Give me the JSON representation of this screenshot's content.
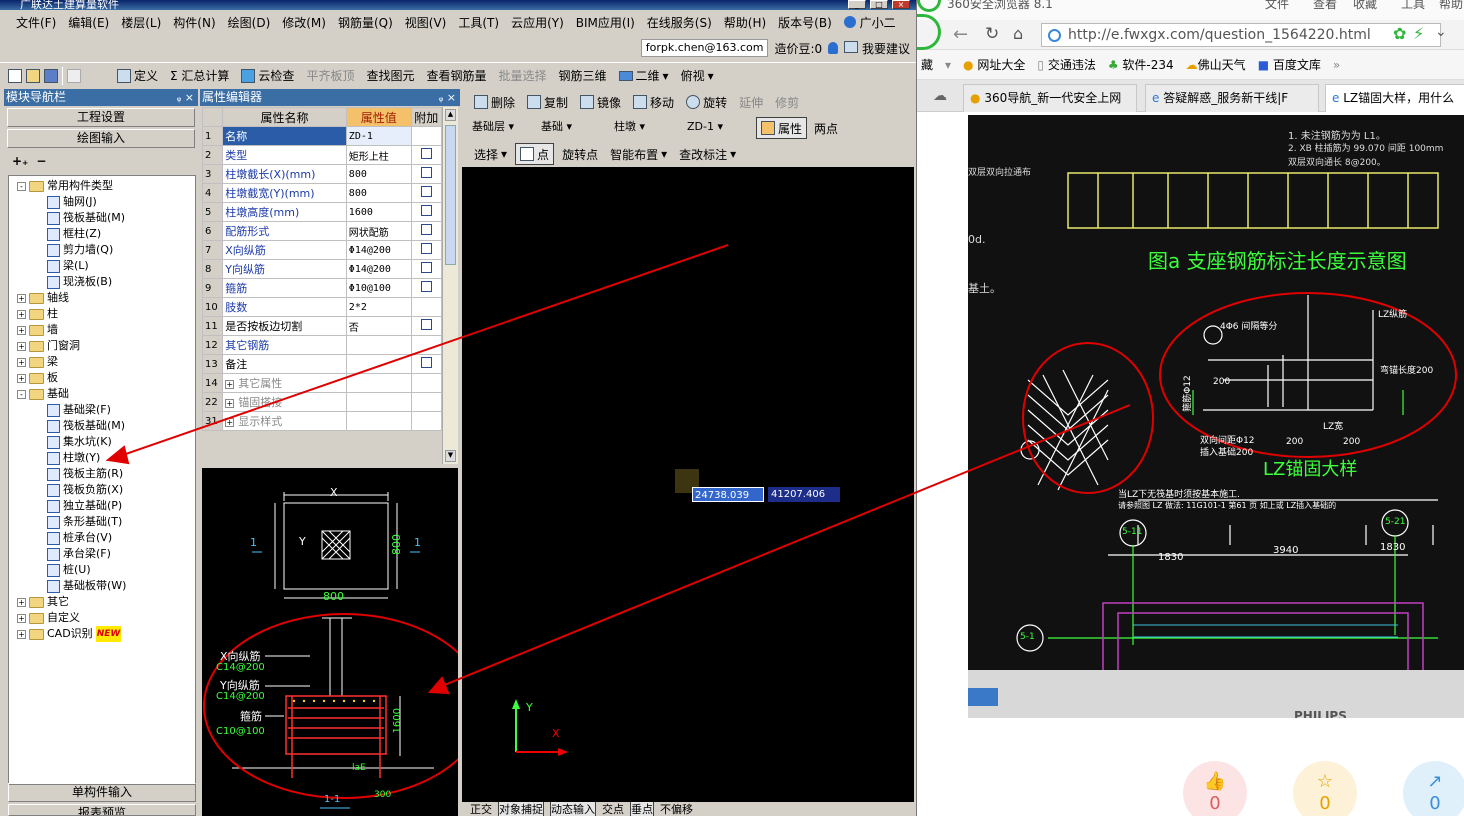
{
  "app": {
    "title": "广联达土建算量软件",
    "menu": [
      "文件(F)",
      "编辑(E)",
      "楼层(L)",
      "构件(N)",
      "绘图(D)",
      "修改(M)",
      "钢筋量(Q)",
      "视图(V)",
      "工具(T)",
      "云应用(Y)",
      "BIM应用(I)",
      "在线服务(S)",
      "帮助(H)",
      "版本号(B)",
      "广小二"
    ],
    "account": "forpk.chen@163.com",
    "price_bean": "造价豆:0",
    "suggest": "我要建议",
    "toolbar": [
      "定义",
      "Σ 汇总计算",
      "云检查",
      "平齐板顶",
      "查找图元",
      "查看钢筋量",
      "批量选择",
      "钢筋三维",
      "二维",
      "俯视"
    ],
    "colors": {
      "title": "#0a246a",
      "accent": "#3a6ea5",
      "cad_bg": "#000000",
      "red": "#e00000"
    }
  },
  "nav": {
    "title": "模块导航栏",
    "btn_project": "工程设置",
    "btn_draw": "绘图输入",
    "tree": [
      {
        "label": "常用构件类型",
        "type": "folder",
        "level": 0,
        "exp": "-"
      },
      {
        "label": "轴网(J)",
        "type": "leaf",
        "level": 1
      },
      {
        "label": "筏板基础(M)",
        "type": "leaf",
        "level": 1
      },
      {
        "label": "框柱(Z)",
        "type": "leaf",
        "level": 1
      },
      {
        "label": "剪力墙(Q)",
        "type": "leaf",
        "level": 1
      },
      {
        "label": "梁(L)",
        "type": "leaf",
        "level": 1
      },
      {
        "label": "现浇板(B)",
        "type": "leaf",
        "level": 1
      },
      {
        "label": "轴线",
        "type": "folder",
        "level": 0,
        "exp": "+"
      },
      {
        "label": "柱",
        "type": "folder",
        "level": 0,
        "exp": "+"
      },
      {
        "label": "墙",
        "type": "folder",
        "level": 0,
        "exp": "+"
      },
      {
        "label": "门窗洞",
        "type": "folder",
        "level": 0,
        "exp": "+"
      },
      {
        "label": "梁",
        "type": "folder",
        "level": 0,
        "exp": "+"
      },
      {
        "label": "板",
        "type": "folder",
        "level": 0,
        "exp": "+"
      },
      {
        "label": "基础",
        "type": "folder",
        "level": 0,
        "exp": "-"
      },
      {
        "label": "基础梁(F)",
        "type": "leaf",
        "level": 1
      },
      {
        "label": "筏板基础(M)",
        "type": "leaf",
        "level": 1
      },
      {
        "label": "集水坑(K)",
        "type": "leaf",
        "level": 1
      },
      {
        "label": "柱墩(Y)",
        "type": "leaf",
        "level": 1
      },
      {
        "label": "筏板主筋(R)",
        "type": "leaf",
        "level": 1
      },
      {
        "label": "筏板负筋(X)",
        "type": "leaf",
        "level": 1
      },
      {
        "label": "独立基础(P)",
        "type": "leaf",
        "level": 1
      },
      {
        "label": "条形基础(T)",
        "type": "leaf",
        "level": 1
      },
      {
        "label": "桩承台(V)",
        "type": "leaf",
        "level": 1
      },
      {
        "label": "承台梁(F)",
        "type": "leaf",
        "level": 1
      },
      {
        "label": "桩(U)",
        "type": "leaf",
        "level": 1
      },
      {
        "label": "基础板带(W)",
        "type": "leaf",
        "level": 1
      },
      {
        "label": "其它",
        "type": "folder",
        "level": 0,
        "exp": "+"
      },
      {
        "label": "自定义",
        "type": "folder",
        "level": 0,
        "exp": "+"
      },
      {
        "label": "CAD识别",
        "type": "folder",
        "level": 0,
        "exp": "+",
        "badge": "NEW"
      }
    ],
    "btn_single": "单构件输入",
    "btn_report": "报表预览"
  },
  "prop": {
    "title": "属性编辑器",
    "col_name": "属性名称",
    "col_value": "属性值",
    "col_extra": "附加",
    "rows": [
      {
        "n": "1",
        "name": "名称",
        "value": "ZD-1",
        "ck": false,
        "style": "sel"
      },
      {
        "n": "2",
        "name": "类型",
        "value": "矩形上柱",
        "ck": true,
        "style": ""
      },
      {
        "n": "3",
        "name": "柱墩截长(X)(mm)",
        "value": "800",
        "ck": true,
        "style": ""
      },
      {
        "n": "4",
        "name": "柱墩截宽(Y)(mm)",
        "value": "800",
        "ck": true,
        "style": ""
      },
      {
        "n": "5",
        "name": "柱墩高度(mm)",
        "value": "1600",
        "ck": true,
        "style": ""
      },
      {
        "n": "6",
        "name": "配筋形式",
        "value": "网状配筋",
        "ck": true,
        "style": ""
      },
      {
        "n": "7",
        "name": "X向纵筋",
        "value": "Φ14@200",
        "ck": true,
        "style": ""
      },
      {
        "n": "8",
        "name": "Y向纵筋",
        "value": "Φ14@200",
        "ck": true,
        "style": ""
      },
      {
        "n": "9",
        "name": "箍筋",
        "value": "Φ10@100",
        "ck": true,
        "style": ""
      },
      {
        "n": "10",
        "name": "肢数",
        "value": "2*2",
        "ck": false,
        "style": ""
      },
      {
        "n": "11",
        "name": "是否按板边切割",
        "value": "否",
        "ck": true,
        "style": "black"
      },
      {
        "n": "12",
        "name": "其它钢筋",
        "value": "",
        "ck": false,
        "style": ""
      },
      {
        "n": "13",
        "name": "备注",
        "value": "",
        "ck": true,
        "style": "black"
      },
      {
        "n": "14",
        "name": "其它属性",
        "value": "",
        "ck": false,
        "style": "gray",
        "expand": "+"
      },
      {
        "n": "22",
        "name": "锚固搭接",
        "value": "",
        "ck": false,
        "style": "gray",
        "expand": "+"
      },
      {
        "n": "31",
        "name": "显示样式",
        "value": "",
        "ck": false,
        "style": "gray",
        "expand": "+"
      }
    ]
  },
  "preview": {
    "x_label": "X",
    "y_label": "Y",
    "dim_800": "800",
    "dim_800b": "800",
    "sec": "1",
    "xbar": "X向纵筋",
    "xbar_spec": "C14@200",
    "ybar": "Y向纵筋",
    "ybar_spec": "C14@200",
    "stirrup": "箍筋",
    "stirrup_spec": "C10@100",
    "height": "1600",
    "lae": "laE",
    "bottom": "300",
    "bottom_label": "1-1"
  },
  "draw": {
    "tb1": [
      "删除",
      "复制",
      "镜像",
      "移动",
      "旋转",
      "延伸",
      "修剪"
    ],
    "floor": "基础层",
    "cat": "基础",
    "type": "柱墩",
    "comp": "ZD-1",
    "attr_btn": "属性",
    "twopt": "两点",
    "tb3": [
      "选择",
      "点",
      "旋转点",
      "智能布置",
      "查改标注"
    ],
    "coord_x": "24738.039",
    "coord_y": "41207.406",
    "axis_y": "Y",
    "axis_x": "X",
    "status": [
      "正交",
      "对象捕捉",
      "动态输入",
      "交点",
      "垂点",
      "不偏移"
    ]
  },
  "browser": {
    "title": "360安全浏览器 8.1",
    "title_menu": [
      "文件",
      "查看",
      "收藏",
      "工具",
      "帮助"
    ],
    "url": "http://e.fwxgx.com/question_1564220.html",
    "fav": [
      "网址大全",
      "交通违法",
      "软件-234",
      "佛山天气",
      "百度文库"
    ],
    "fav_prefix": "藏",
    "tabs": [
      "360导航_新一代安全上网",
      "答疑解惑_服务新干线|F",
      "LZ锚固大样，用什么"
    ],
    "photo": {
      "title": "图a 支座钢筋标注长度示意图",
      "lz_title": "LZ锚固大样",
      "notes": [
        "1. 未注钢筋为为 L1。",
        "2. XB 柱插筋为 99.070 间距 100mm",
        "双层双向通长 8@200。"
      ],
      "side_a": "双层双向拉通布",
      "side_b": "0d.",
      "side_c": "基土。",
      "dims": [
        "1830",
        "3940",
        "1830"
      ],
      "axes": [
        "5-11",
        "5-21",
        "5-1"
      ],
      "texts": [
        "4Φ6 间隔等分",
        "LZ纵筋",
        "弯锚长度200",
        "箍筋Φ12",
        "双向间距Φ12",
        "插入基础200",
        "LZ宽",
        "200",
        "200",
        "200",
        "当LZ下无筏基时须按基本施工.",
        "请参照图 LZ 做法: 11G101-1 第61 页 如上或 LZ插入基础的"
      ],
      "mon": "PHILIPS"
    },
    "actions": [
      {
        "icon": "👍",
        "count": "0"
      },
      {
        "icon": "☆",
        "count": "0"
      },
      {
        "icon": "↗",
        "count": "0"
      }
    ]
  }
}
